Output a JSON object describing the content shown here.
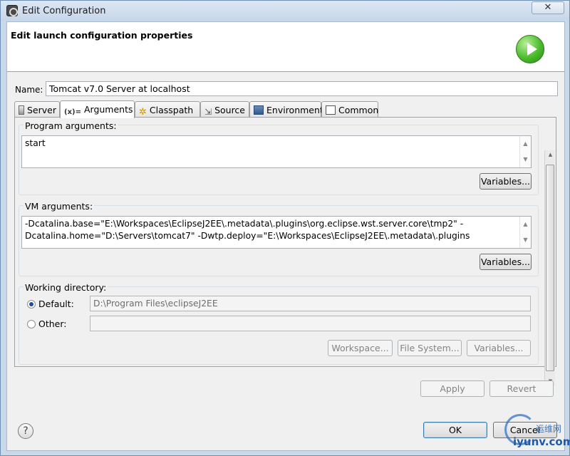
{
  "window": {
    "title": "Edit Configuration",
    "close_glyph": "✕"
  },
  "header": {
    "heading": "Edit launch configuration properties",
    "icon": "run-icon"
  },
  "name": {
    "label": "Name:",
    "value": "Tomcat v7.0 Server at localhost"
  },
  "tabs": [
    {
      "label": "Server",
      "icon": "server-icon"
    },
    {
      "label": "Arguments",
      "icon": "arguments-icon",
      "icon_text": "(x)="
    },
    {
      "label": "Classpath",
      "icon": "classpath-icon"
    },
    {
      "label": "Source",
      "icon": "source-icon"
    },
    {
      "label": "Environment",
      "icon": "environment-icon"
    },
    {
      "label": "Common",
      "icon": "common-icon"
    }
  ],
  "active_tab": "Arguments",
  "program_args": {
    "label": "Program arguments:",
    "value": "start",
    "variables_label": "Variables..."
  },
  "vm_args": {
    "label": "VM arguments:",
    "line1": "-Dcatalina.base=\"E:\\Workspaces\\EclipseJ2EE\\.metadata\\.plugins\\org.eclipse.wst.server.core\\tmp2\" -",
    "line2": "Dcatalina.home=\"D:\\Servers\\tomcat7\" -Dwtp.deploy=\"E:\\Workspaces\\EclipseJ2EE\\.metadata\\.plugins",
    "variables_label": "Variables..."
  },
  "working_dir": {
    "label": "Working directory:",
    "default_label": "Default:",
    "default_value": "D:\\Program Files\\eclipseJ2EE",
    "other_label": "Other:",
    "other_value": "",
    "workspace_label": "Workspace...",
    "filesystem_label": "File System...",
    "variables_label": "Variables..."
  },
  "actions": {
    "apply_label": "Apply",
    "revert_label": "Revert"
  },
  "footer": {
    "help_glyph": "?",
    "ok_label": "OK",
    "cancel_label": "Cancel"
  },
  "watermark": {
    "text": "iyunv.com",
    "cn": "运维网"
  }
}
